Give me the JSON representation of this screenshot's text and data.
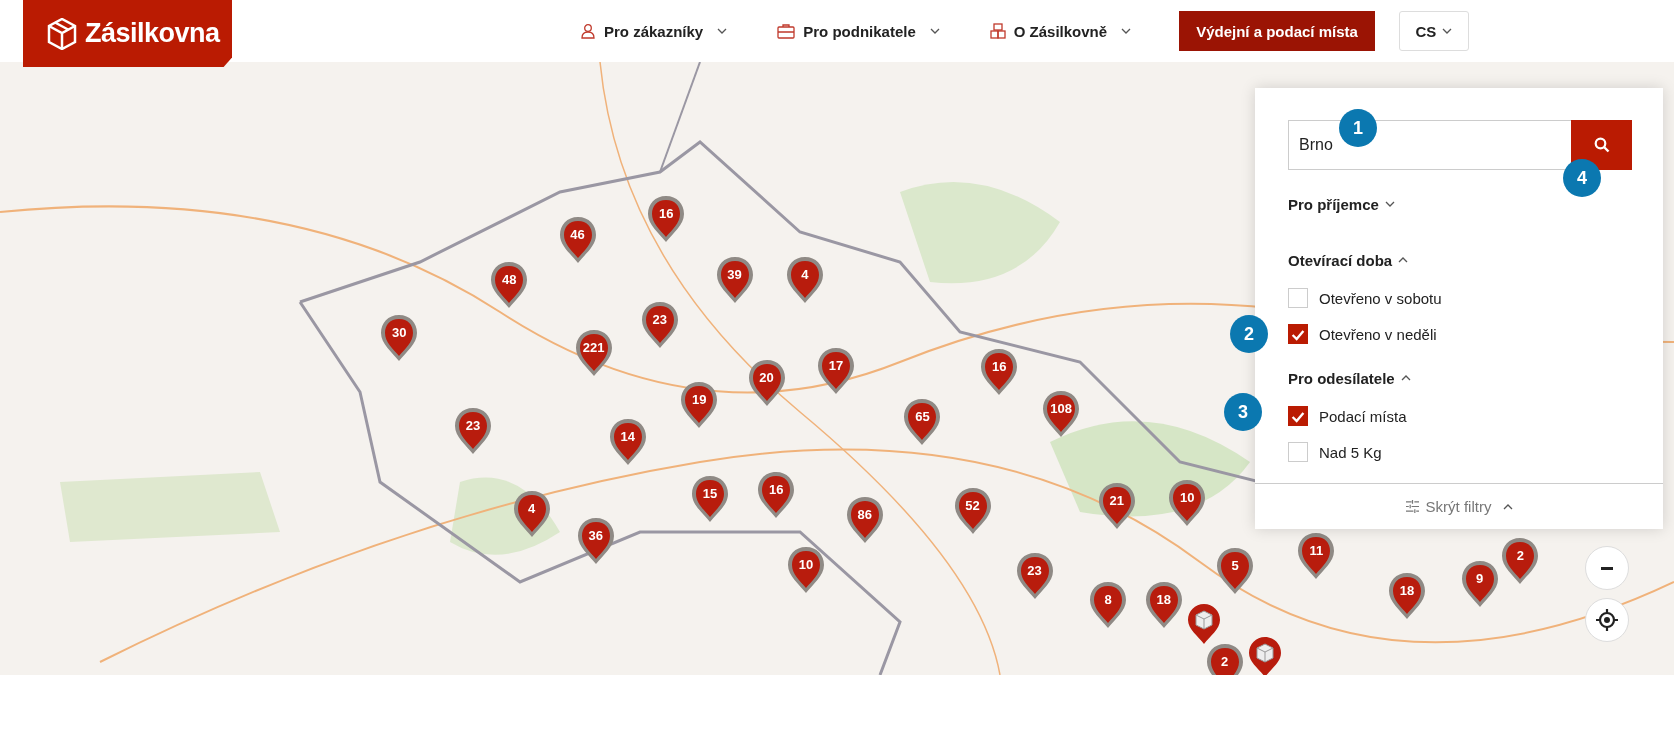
{
  "header": {
    "logo": "Zásilkovna",
    "nav": [
      {
        "label": "Pro zákazníky",
        "kind": "person"
      },
      {
        "label": "Pro podnikatele",
        "kind": "briefcase"
      },
      {
        "label": "O Zásilkovně",
        "kind": "boxes"
      }
    ],
    "cta": "Výdejní a podací místa",
    "language": "CS"
  },
  "map": {
    "kind": "picture",
    "pins": [
      {
        "kind": "cluster",
        "count": "46"
      },
      {
        "kind": "cluster",
        "count": "16"
      },
      {
        "kind": "cluster",
        "count": "48"
      },
      {
        "kind": "cluster",
        "count": "39"
      },
      {
        "kind": "cluster",
        "count": "4"
      },
      {
        "kind": "cluster",
        "count": "30"
      },
      {
        "kind": "cluster",
        "count": "221"
      },
      {
        "kind": "cluster",
        "count": "23"
      },
      {
        "kind": "cluster",
        "count": "20"
      },
      {
        "kind": "cluster",
        "count": "17"
      },
      {
        "kind": "cluster",
        "count": "16"
      },
      {
        "kind": "cluster",
        "count": "19"
      },
      {
        "kind": "cluster",
        "count": "65"
      },
      {
        "kind": "cluster",
        "count": "108"
      },
      {
        "kind": "cluster",
        "count": "23"
      },
      {
        "kind": "cluster",
        "count": "14"
      },
      {
        "kind": "cluster",
        "count": "15"
      },
      {
        "kind": "cluster",
        "count": "16"
      },
      {
        "kind": "cluster",
        "count": "86"
      },
      {
        "kind": "cluster",
        "count": "52"
      },
      {
        "kind": "cluster",
        "count": "21"
      },
      {
        "kind": "cluster",
        "count": "10"
      },
      {
        "kind": "cluster",
        "count": "4"
      },
      {
        "kind": "cluster",
        "count": "36"
      },
      {
        "kind": "cluster",
        "count": "10"
      },
      {
        "kind": "cluster",
        "count": "23"
      },
      {
        "kind": "cluster",
        "count": "11"
      },
      {
        "kind": "cluster",
        "count": "5"
      },
      {
        "kind": "cluster",
        "count": "2"
      },
      {
        "kind": "cluster",
        "count": "18"
      },
      {
        "kind": "cluster",
        "count": "9"
      },
      {
        "kind": "cluster",
        "count": "8"
      },
      {
        "kind": "cluster",
        "count": "18"
      },
      {
        "kind": "cluster",
        "count": "2"
      },
      {
        "kind": "parcel"
      },
      {
        "kind": "parcel"
      }
    ]
  },
  "filters": {
    "search": {
      "value": "Brno"
    },
    "sections": [
      {
        "title": "Pro příjemce",
        "expanded": false
      },
      {
        "title": "Otevírací doba",
        "expanded": true,
        "options": [
          {
            "label": "Otevřeno v sobotu",
            "checked": false
          },
          {
            "label": "Otevřeno v neděli",
            "checked": true
          }
        ]
      },
      {
        "title": "Pro odesílatele",
        "expanded": true,
        "options": [
          {
            "label": "Podací místa",
            "checked": true
          },
          {
            "label": "Nad 5 Kg",
            "checked": false
          }
        ]
      }
    ],
    "toggle": "Skrýt filtry"
  },
  "annotations": [
    {
      "label": "1"
    },
    {
      "label": "2"
    },
    {
      "label": "3"
    },
    {
      "label": "4"
    }
  ]
}
